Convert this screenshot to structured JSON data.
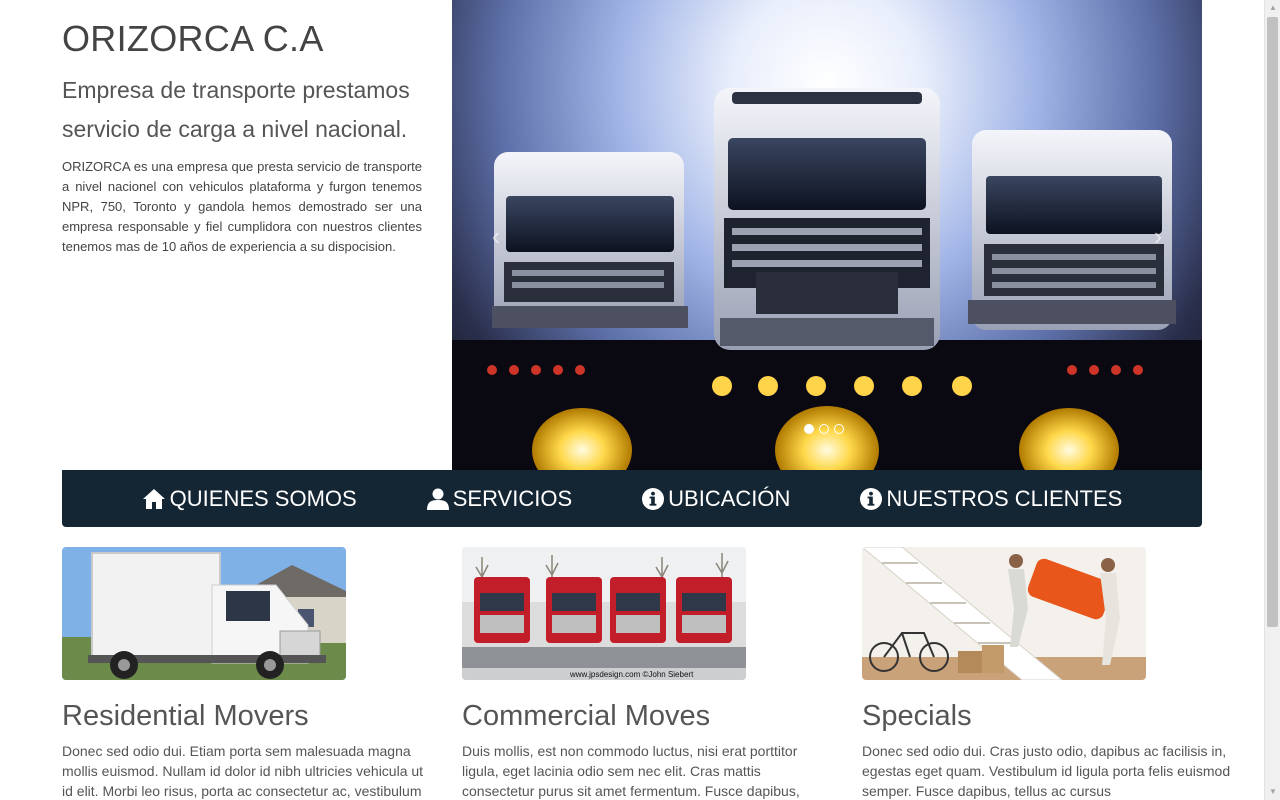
{
  "hero": {
    "brand": "ORIZORCA C.A",
    "tagline": "Empresa de transporte prestamos servicio de carga a nivel nacional.",
    "description": "ORIZORCA es una empresa que presta servicio de transporte a nivel nacionel con vehiculos plataforma y furgon tenemos NPR, 750, Toronto y gandola hemos demostrado ser una empresa responsable y fiel cumplidora con nuestros clientes tenemos mas de 10 años de experiencia a su dispocision."
  },
  "carousel": {
    "slide_icon": "trucks-image",
    "prev_icon": "chevron-left-icon",
    "next_icon": "chevron-right-icon",
    "slide_count": 3,
    "active_slide": 1
  },
  "nav": {
    "items": [
      {
        "label": "QUIENES SOMOS",
        "icon": "home-icon"
      },
      {
        "label": "SERVICIOS",
        "icon": "user-icon"
      },
      {
        "label": "UBICACIÓN",
        "icon": "info-icon"
      },
      {
        "label": "NUESTROS CLIENTES",
        "icon": "info-icon"
      }
    ]
  },
  "features": [
    {
      "title": "Residential Movers",
      "text": "Donec sed odio dui. Etiam porta sem malesuada magna mollis euismod. Nullam id dolor id nibh ultricies vehicula ut id elit. Morbi leo risus, porta ac consectetur ac, vestibulum",
      "image": "white-box-truck-image"
    },
    {
      "title": "Commercial Moves",
      "text": "Duis mollis, est non commodo luctus, nisi erat porttitor ligula, eget lacinia odio sem nec elit. Cras mattis consectetur purus sit amet fermentum. Fusce dapibus,",
      "image": "red-trucks-fleet-image",
      "image_caption": "www.jpsdesign.com ©John Siebert"
    },
    {
      "title": "Specials",
      "text": "Donec sed odio dui. Cras justo odio, dapibus ac facilisis in, egestas eget quam. Vestibulum id ligula porta felis euismod semper. Fusce dapibus, tellus ac cursus",
      "image": "movers-carrying-sofa-image"
    }
  ],
  "colors": {
    "navbar": "#142533",
    "text": "#555555"
  }
}
